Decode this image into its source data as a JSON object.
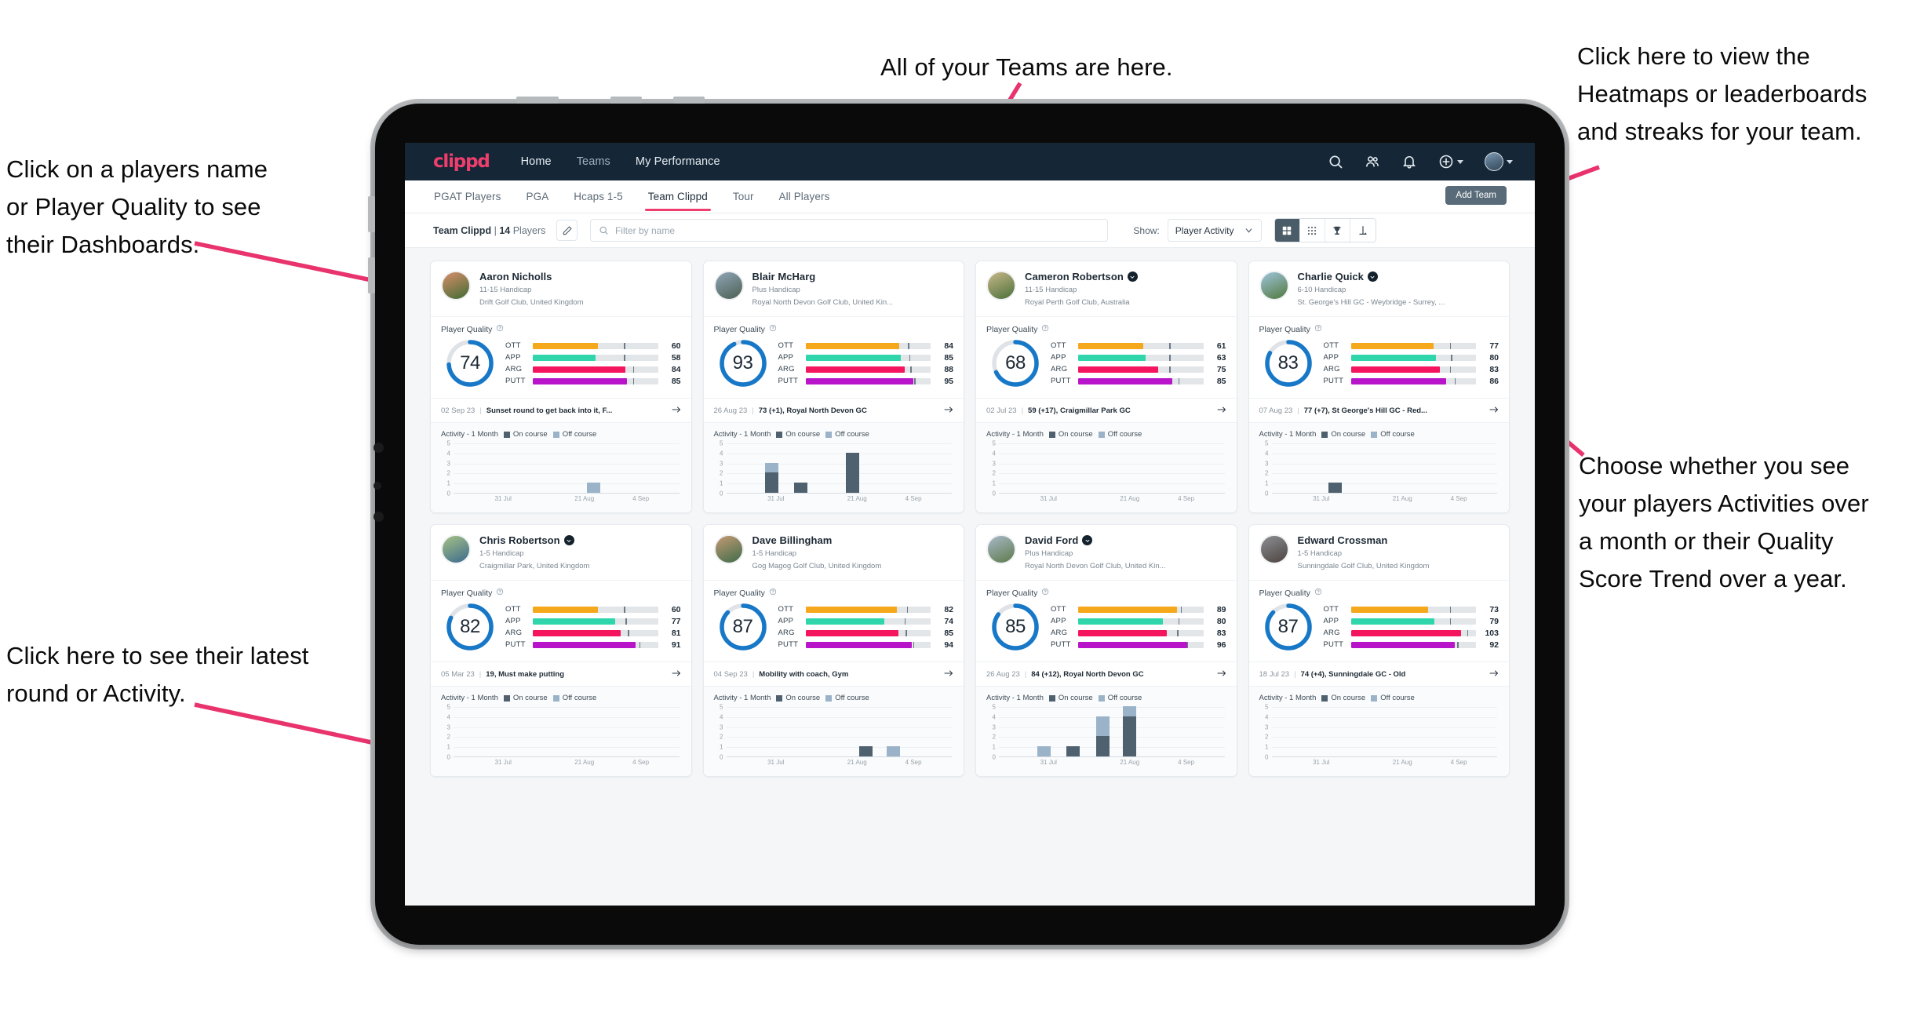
{
  "annotations": [
    {
      "id": "a-teams",
      "text": "All of your Teams are here."
    },
    {
      "id": "a-heatmaps",
      "text": "Click here to view the\nHeatmaps or leaderboards\nand streaks for your team."
    },
    {
      "id": "a-names",
      "text": "Click on a players name\nor Player Quality to see\ntheir Dashboards."
    },
    {
      "id": "a-choose",
      "text": "Choose whether you see\nyour players Activities over\na month or their Quality\nScore Trend over a year."
    },
    {
      "id": "a-latest",
      "text": "Click here to see their latest\nround or Activity."
    }
  ],
  "topnav": {
    "logo": "clippd",
    "links": [
      {
        "label": "Home",
        "active": true
      },
      {
        "label": "Teams",
        "active": false
      },
      {
        "label": "My Performance",
        "active": true
      }
    ],
    "icons": [
      "search-icon",
      "people-icon",
      "bell-icon",
      "plus-circle-icon",
      "avatar"
    ]
  },
  "tabs": [
    {
      "label": "PGAT Players",
      "active": false
    },
    {
      "label": "PGA",
      "active": false
    },
    {
      "label": "Hcaps 1-5",
      "active": false
    },
    {
      "label": "Team Clippd",
      "active": true
    },
    {
      "label": "Tour",
      "active": false
    },
    {
      "label": "All Players",
      "active": false
    }
  ],
  "add_team_label": "Add Team",
  "filterbar": {
    "team_name": "Team Clippd",
    "separator": "|",
    "player_count": "14",
    "players_word": "Players",
    "edit_icon": "pencil-icon",
    "search_placeholder": "Filter by name",
    "search_value": "",
    "show_label": "Show:",
    "show_selected": "Player Activity",
    "show_options": [
      "Player Activity",
      "Quality Score Trend"
    ],
    "view_buttons": [
      "grid-view-icon",
      "dots-grid-icon",
      "trophy-icon",
      "golf-flag-icon"
    ],
    "view_active_index": 0
  },
  "colors": {
    "accent_pink": "#ef3e6d",
    "navy": "#152737",
    "ring_blue": "#1878c8",
    "ott": "#f5a81c",
    "app": "#2fd6ab",
    "arg": "#f4155e",
    "putt": "#b814c9",
    "on_course": "#4f616f",
    "off_course": "#9bb3c8"
  },
  "quality_label": "Player Quality",
  "activity_label": "Activity - 1 Month",
  "legend": {
    "on": "On course",
    "off": "Off course"
  },
  "chart_data": {
    "type": "bar",
    "title": "Activity - 1 Month",
    "ylim": [
      0,
      5
    ],
    "yticks": [
      0,
      1,
      2,
      3,
      4,
      5
    ],
    "xtick_labels": [
      "31 Jul",
      "21 Aug",
      "4 Sep"
    ],
    "xtick_positions": [
      0.22,
      0.58,
      0.83
    ],
    "series": [
      {
        "name": "On course",
        "color": "#4f616f"
      },
      {
        "name": "Off course",
        "color": "#9bb3c8"
      }
    ],
    "legend_position": "top",
    "grid": true
  },
  "players": [
    {
      "name": "Aaron Nicholls",
      "verified": false,
      "handicap": "11-15 Handicap",
      "club": "Drift Golf Club, United Kingdom",
      "avatar_from": "#d98e6a",
      "avatar_to": "#3f6b33",
      "score": 74,
      "metrics": [
        {
          "label": "OTT",
          "value": 60,
          "fill": 0.52,
          "tick": 0.73,
          "color": "#f5a81c"
        },
        {
          "label": "APP",
          "value": 58,
          "fill": 0.5,
          "tick": 0.73,
          "color": "#2fd6ab"
        },
        {
          "label": "ARG",
          "value": 84,
          "fill": 0.74,
          "tick": 0.8,
          "color": "#f4155e"
        },
        {
          "label": "PUTT",
          "value": 85,
          "fill": 0.75,
          "tick": 0.8,
          "color": "#b814c9"
        }
      ],
      "round_date": "02 Sep 23",
      "round_text": "Sunset round to get back into it, F...",
      "bars": [
        {
          "x": 0.62,
          "on": 0,
          "off": 1
        }
      ]
    },
    {
      "name": "Blair McHarg",
      "verified": false,
      "handicap": "Plus Handicap",
      "club": "Royal North Devon Golf Club, United Kin...",
      "avatar_from": "#8fa6b8",
      "avatar_to": "#4c5f52",
      "score": 93,
      "metrics": [
        {
          "label": "OTT",
          "value": 84,
          "fill": 0.75,
          "tick": 0.82,
          "color": "#f5a81c"
        },
        {
          "label": "APP",
          "value": 85,
          "fill": 0.76,
          "tick": 0.83,
          "color": "#2fd6ab"
        },
        {
          "label": "ARG",
          "value": 88,
          "fill": 0.79,
          "tick": 0.84,
          "color": "#f4155e"
        },
        {
          "label": "PUTT",
          "value": 95,
          "fill": 0.86,
          "tick": 0.87,
          "color": "#b814c9"
        }
      ],
      "round_date": "26 Aug 23",
      "round_text": "73 (+1), Royal North Devon GC",
      "bars": [
        {
          "x": 0.2,
          "on": 2,
          "off": 1
        },
        {
          "x": 0.33,
          "on": 1,
          "off": 0
        },
        {
          "x": 0.56,
          "on": 4,
          "off": 0
        }
      ]
    },
    {
      "name": "Cameron Robertson",
      "verified": true,
      "handicap": "11-15 Handicap",
      "club": "Royal Perth Golf Club, Australia",
      "avatar_from": "#c8b78a",
      "avatar_to": "#4a7038",
      "score": 68,
      "metrics": [
        {
          "label": "OTT",
          "value": 61,
          "fill": 0.52,
          "tick": 0.73,
          "color": "#f5a81c"
        },
        {
          "label": "APP",
          "value": 63,
          "fill": 0.54,
          "tick": 0.73,
          "color": "#2fd6ab"
        },
        {
          "label": "ARG",
          "value": 75,
          "fill": 0.64,
          "tick": 0.73,
          "color": "#f4155e"
        },
        {
          "label": "PUTT",
          "value": 85,
          "fill": 0.75,
          "tick": 0.8,
          "color": "#b814c9"
        }
      ],
      "round_date": "02 Jul 23",
      "round_text": "59 (+17), Craigmillar Park GC",
      "bars": []
    },
    {
      "name": "Charlie Quick",
      "verified": true,
      "handicap": "6-10 Handicap",
      "club": "St. George's Hill GC - Weybridge - Surrey, ...",
      "avatar_from": "#9fc4dd",
      "avatar_to": "#51793c",
      "score": 83,
      "metrics": [
        {
          "label": "OTT",
          "value": 77,
          "fill": 0.66,
          "tick": 0.79,
          "color": "#f5a81c"
        },
        {
          "label": "APP",
          "value": 80,
          "fill": 0.68,
          "tick": 0.8,
          "color": "#2fd6ab"
        },
        {
          "label": "ARG",
          "value": 83,
          "fill": 0.71,
          "tick": 0.79,
          "color": "#f4155e"
        },
        {
          "label": "PUTT",
          "value": 86,
          "fill": 0.76,
          "tick": 0.83,
          "color": "#b814c9"
        }
      ],
      "round_date": "07 Aug 23",
      "round_text": "77 (+7), St George's Hill GC - Red...",
      "bars": [
        {
          "x": 0.28,
          "on": 1,
          "off": 0
        }
      ]
    },
    {
      "name": "Chris Robertson",
      "verified": true,
      "handicap": "1-5 Handicap",
      "club": "Craigmillar Park, United Kingdom",
      "avatar_from": "#a6c285",
      "avatar_to": "#3c6a8e",
      "score": 82,
      "metrics": [
        {
          "label": "OTT",
          "value": 60,
          "fill": 0.52,
          "tick": 0.73,
          "color": "#f5a81c"
        },
        {
          "label": "APP",
          "value": 77,
          "fill": 0.66,
          "tick": 0.74,
          "color": "#2fd6ab"
        },
        {
          "label": "ARG",
          "value": 81,
          "fill": 0.7,
          "tick": 0.76,
          "color": "#f4155e"
        },
        {
          "label": "PUTT",
          "value": 91,
          "fill": 0.82,
          "tick": 0.85,
          "color": "#b814c9"
        }
      ],
      "round_date": "05 Mar 23",
      "round_text": "19, Must make putting",
      "bars": []
    },
    {
      "name": "Dave Billingham",
      "verified": false,
      "handicap": "1-5 Handicap",
      "club": "Gog Magog Golf Club, United Kingdom",
      "avatar_from": "#c59a74",
      "avatar_to": "#3e6c4a",
      "score": 87,
      "metrics": [
        {
          "label": "OTT",
          "value": 82,
          "fill": 0.73,
          "tick": 0.81,
          "color": "#f5a81c"
        },
        {
          "label": "APP",
          "value": 74,
          "fill": 0.63,
          "tick": 0.79,
          "color": "#2fd6ab"
        },
        {
          "label": "ARG",
          "value": 85,
          "fill": 0.74,
          "tick": 0.8,
          "color": "#f4155e"
        },
        {
          "label": "PUTT",
          "value": 94,
          "fill": 0.85,
          "tick": 0.86,
          "color": "#b814c9"
        }
      ],
      "round_date": "04 Sep 23",
      "round_text": "Mobility with coach, Gym",
      "bars": [
        {
          "x": 0.62,
          "on": 1,
          "off": 0
        },
        {
          "x": 0.74,
          "on": 0,
          "off": 1
        }
      ]
    },
    {
      "name": "David Ford",
      "verified": true,
      "handicap": "Plus Handicap",
      "club": "Royal North Devon Golf Club, United Kin...",
      "avatar_from": "#a8b9c9",
      "avatar_to": "#5d7a4a",
      "score": 85,
      "metrics": [
        {
          "label": "OTT",
          "value": 89,
          "fill": 0.79,
          "tick": 0.82,
          "color": "#f5a81c"
        },
        {
          "label": "APP",
          "value": 80,
          "fill": 0.68,
          "tick": 0.8,
          "color": "#2fd6ab"
        },
        {
          "label": "ARG",
          "value": 83,
          "fill": 0.71,
          "tick": 0.79,
          "color": "#f4155e"
        },
        {
          "label": "PUTT",
          "value": 96,
          "fill": 0.87,
          "tick": 0.87,
          "color": "#b814c9"
        }
      ],
      "round_date": "26 Aug 23",
      "round_text": "84 (+12), Royal North Devon GC",
      "bars": [
        {
          "x": 0.2,
          "on": 0,
          "off": 1
        },
        {
          "x": 0.33,
          "on": 1,
          "off": 0
        },
        {
          "x": 0.46,
          "on": 2,
          "off": 2
        },
        {
          "x": 0.58,
          "on": 4,
          "off": 1
        }
      ]
    },
    {
      "name": "Edward Crossman",
      "verified": false,
      "handicap": "1-5 Handicap",
      "club": "Sunningdale Golf Club, United Kingdom",
      "avatar_from": "#8d8f94",
      "avatar_to": "#4c4340",
      "score": 87,
      "metrics": [
        {
          "label": "OTT",
          "value": 73,
          "fill": 0.62,
          "tick": 0.79,
          "color": "#f5a81c"
        },
        {
          "label": "APP",
          "value": 79,
          "fill": 0.67,
          "tick": 0.79,
          "color": "#2fd6ab"
        },
        {
          "label": "ARG",
          "value": 103,
          "fill": 0.88,
          "tick": 0.93,
          "color": "#f4155e"
        },
        {
          "label": "PUTT",
          "value": 92,
          "fill": 0.83,
          "tick": 0.85,
          "color": "#b814c9"
        }
      ],
      "round_date": "18 Jul 23",
      "round_text": "74 (+4), Sunningdale GC - Old",
      "bars": []
    }
  ]
}
